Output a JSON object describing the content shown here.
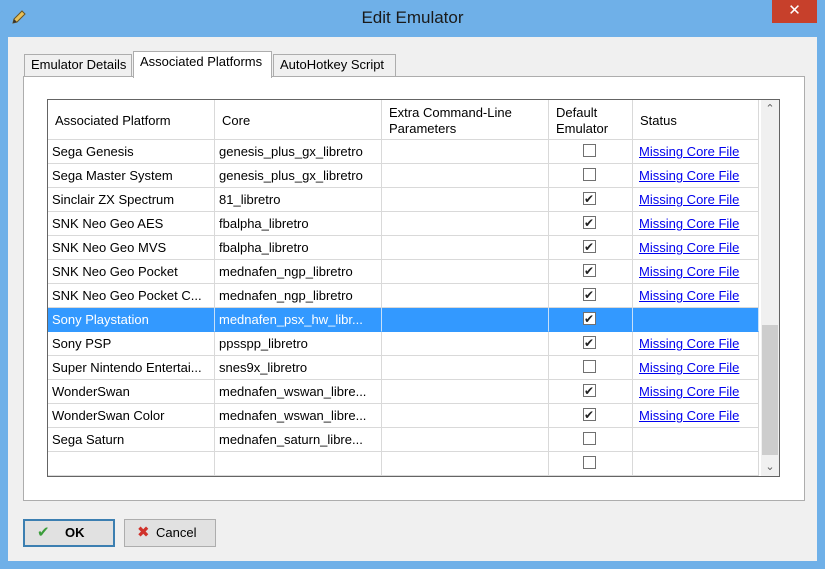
{
  "window": {
    "title": "Edit Emulator",
    "close_label": "✕",
    "accent": "#6fb0e8"
  },
  "tabs": [
    {
      "label": "Emulator Details"
    },
    {
      "label": "Associated Platforms"
    },
    {
      "label": "AutoHotkey Script"
    }
  ],
  "grid": {
    "columns": [
      "Associated Platform",
      "Core",
      "Extra Command-Line Parameters",
      "Default Emulator",
      "Status"
    ],
    "rows": [
      {
        "platform": "Sega Genesis",
        "core": "genesis_plus_gx_libretro",
        "params": "",
        "default": false,
        "status": "Missing Core File"
      },
      {
        "platform": "Sega Master System",
        "core": "genesis_plus_gx_libretro",
        "params": "",
        "default": false,
        "status": "Missing Core File"
      },
      {
        "platform": "Sinclair ZX Spectrum",
        "core": "81_libretro",
        "params": "",
        "default": true,
        "status": "Missing Core File"
      },
      {
        "platform": "SNK Neo Geo AES",
        "core": "fbalpha_libretro",
        "params": "",
        "default": true,
        "status": "Missing Core File"
      },
      {
        "platform": "SNK Neo Geo MVS",
        "core": "fbalpha_libretro",
        "params": "",
        "default": true,
        "status": "Missing Core File"
      },
      {
        "platform": "SNK Neo Geo Pocket",
        "core": "mednafen_ngp_libretro",
        "params": "",
        "default": true,
        "status": "Missing Core File"
      },
      {
        "platform": "SNK Neo Geo Pocket C...",
        "core": "mednafen_ngp_libretro",
        "params": "",
        "default": true,
        "status": "Missing Core File"
      },
      {
        "platform": "Sony Playstation",
        "core": "mednafen_psx_hw_libr...",
        "params": "",
        "default": true,
        "status": "",
        "selected": true
      },
      {
        "platform": "Sony PSP",
        "core": "ppsspp_libretro",
        "params": "",
        "default": true,
        "status": "Missing Core File"
      },
      {
        "platform": "Super Nintendo Entertai...",
        "core": "snes9x_libretro",
        "params": "",
        "default": false,
        "status": "Missing Core File"
      },
      {
        "platform": "WonderSwan",
        "core": "mednafen_wswan_libre...",
        "params": "",
        "default": true,
        "status": "Missing Core File"
      },
      {
        "platform": "WonderSwan Color",
        "core": "mednafen_wswan_libre...",
        "params": "",
        "default": true,
        "status": "Missing Core File"
      },
      {
        "platform": "Sega Saturn",
        "core": "mednafen_saturn_libre...",
        "params": "",
        "default": false,
        "status": ""
      },
      {
        "platform": "",
        "core": "",
        "params": "",
        "default": false,
        "status": ""
      }
    ]
  },
  "buttons": {
    "ok_label": "OK",
    "cancel_label": "Cancel"
  }
}
